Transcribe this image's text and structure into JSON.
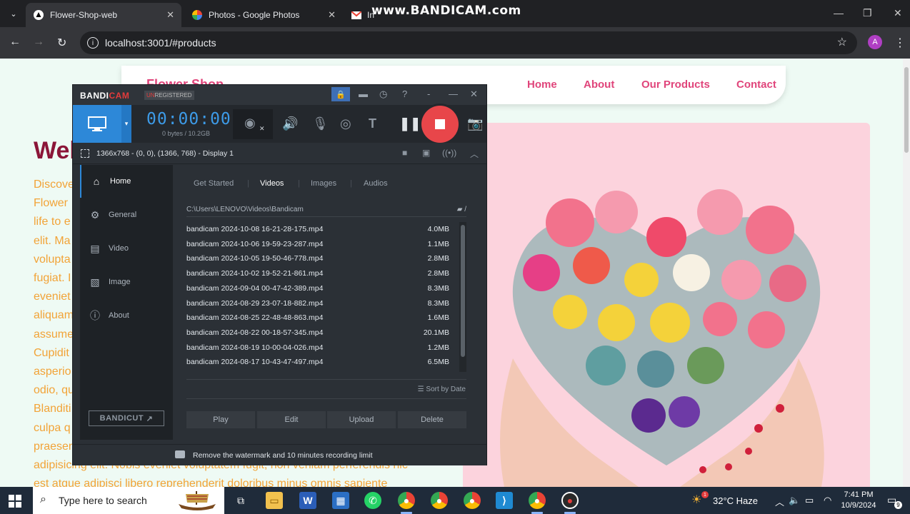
{
  "browser": {
    "tabs": [
      {
        "title": "Flower-Shop-web",
        "icon": "tab-favicon"
      },
      {
        "title": "Photos - Google Photos",
        "icon": "google-photos-icon"
      },
      {
        "title": "In",
        "icon": "gmail-icon"
      }
    ],
    "watermark": "www.BANDICAM.com",
    "url": "localhost:3001/#products",
    "profile_initial": "A"
  },
  "site": {
    "brand": "Flower Shop",
    "nav": [
      "Home",
      "About",
      "Our Products",
      "Contact"
    ],
    "hero_title": "Wel",
    "hero_lines": [
      "Discove",
      "Flower",
      "life to e",
      "elit. Ma",
      "volupta",
      "fugiat. I",
      "eveniet",
      "aliquam",
      "assume",
      "Cupidit",
      "asperio",
      "odio, qu",
      "Blanditi",
      "culpa q",
      "praesen",
      "adipisicing elit. Nobis eveniet voluptatem fugit, non veniam perferendis nic",
      "est atque adipisci libero reprehenderit doloribus minus omnis sapiente"
    ],
    "colors": {
      "brand": "#e0457b",
      "title": "#8b1538",
      "text": "#f2a337",
      "panel": "#fcd3dd"
    }
  },
  "bandicam": {
    "logo_a": "BANDI",
    "logo_b": "CAM",
    "unreg_a": "UN",
    "unreg_b": "REGISTERED",
    "timer": "00:00:00",
    "bytes": "0 bytes / 10.2GB",
    "area": "1366x768 - (0, 0), (1366, 768) - Display 1",
    "sidebar": [
      "Home",
      "General",
      "Video",
      "Image",
      "About"
    ],
    "bandicut": "BANDICUT",
    "tabs": [
      "Get Started",
      "Videos",
      "Images",
      "Audios"
    ],
    "path": "C:\\Users\\LENOVO\\Videos\\Bandicam",
    "path_sep": "/",
    "files": [
      {
        "name": "bandicam 2024-10-08 16-21-28-175.mp4",
        "size": "4.0MB"
      },
      {
        "name": "bandicam 2024-10-06 19-59-23-287.mp4",
        "size": "1.1MB"
      },
      {
        "name": "bandicam 2024-10-05 19-50-46-778.mp4",
        "size": "2.8MB"
      },
      {
        "name": "bandicam 2024-10-02 19-52-21-861.mp4",
        "size": "2.8MB"
      },
      {
        "name": "bandicam 2024-09-04 00-47-42-389.mp4",
        "size": "8.3MB"
      },
      {
        "name": "bandicam 2024-08-29 23-07-18-882.mp4",
        "size": "8.3MB"
      },
      {
        "name": "bandicam 2024-08-25 22-48-48-863.mp4",
        "size": "1.6MB"
      },
      {
        "name": "bandicam 2024-08-22 00-18-57-345.mp4",
        "size": "20.1MB"
      },
      {
        "name": "bandicam 2024-08-19 10-00-04-026.mp4",
        "size": "1.2MB"
      },
      {
        "name": "bandicam 2024-08-17 10-43-47-497.mp4",
        "size": "6.5MB"
      }
    ],
    "sort": "Sort by Date",
    "actions": [
      "Play",
      "Edit",
      "Upload",
      "Delete"
    ],
    "footer": "Remove the watermark and 10 minutes recording limit"
  },
  "taskbar": {
    "search_placeholder": "Type here to search",
    "weather_badge": "1",
    "weather": "32°C  Haze",
    "time": "7:41 PM",
    "date": "10/9/2024",
    "notifications": "9"
  }
}
